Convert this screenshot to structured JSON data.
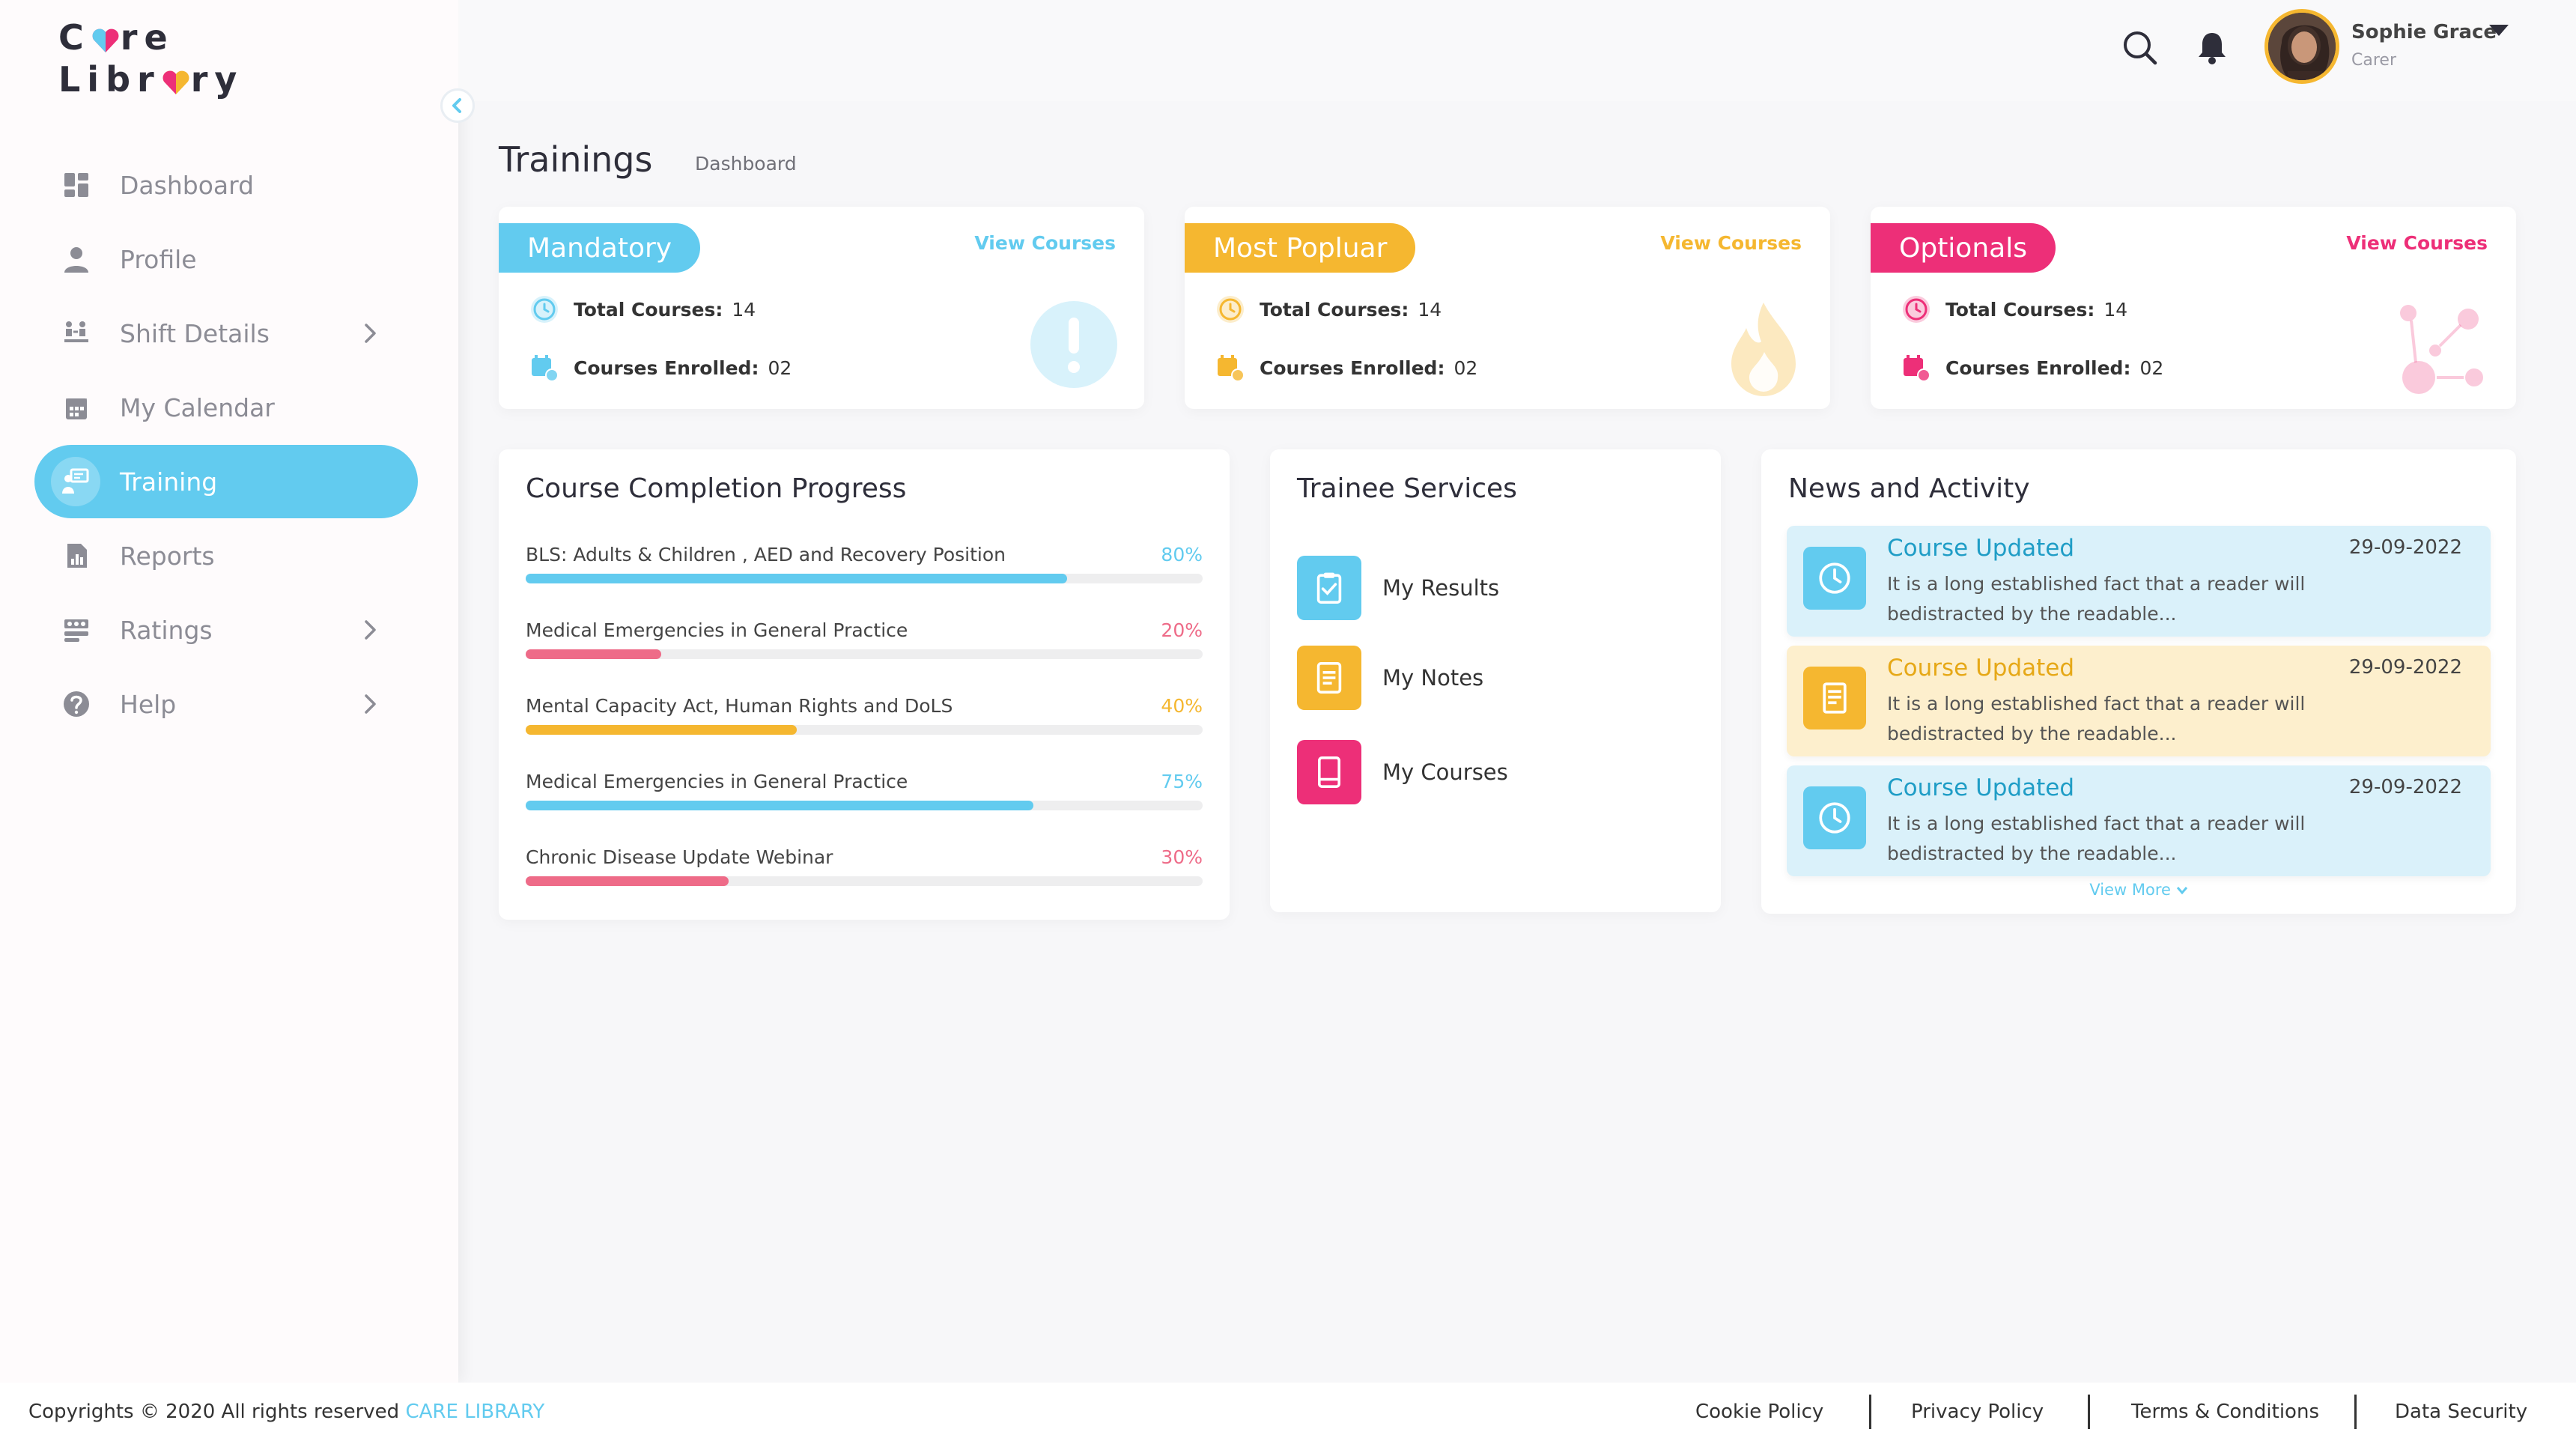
{
  "brand": {
    "logo_line1": "C",
    "logo_line1_rest": "re",
    "logo_line2": "Libr",
    "logo_line2_rest": "ry"
  },
  "nav": [
    {
      "label": "Dashboard",
      "icon": "dashboard-icon",
      "active": false,
      "chevron": false
    },
    {
      "label": "Profile",
      "icon": "user-icon",
      "active": false,
      "chevron": false
    },
    {
      "label": "Shift Details",
      "icon": "shift-icon",
      "active": false,
      "chevron": true
    },
    {
      "label": "My Calendar",
      "icon": "calendar-icon",
      "active": false,
      "chevron": false
    },
    {
      "label": "Training",
      "icon": "training-icon",
      "active": true,
      "chevron": false
    },
    {
      "label": "Reports",
      "icon": "reports-icon",
      "active": false,
      "chevron": false
    },
    {
      "label": "Ratings",
      "icon": "ratings-icon",
      "active": false,
      "chevron": true
    },
    {
      "label": "Help",
      "icon": "help-icon",
      "active": false,
      "chevron": true
    }
  ],
  "user": {
    "name": "Sophie Grace",
    "role": "Carer"
  },
  "page": {
    "title": "Trainings",
    "breadcrumb": "Dashboard"
  },
  "categories": [
    {
      "title": "Mandatory",
      "link": "View Courses",
      "total_label": "Total Courses:",
      "total": "14",
      "enrolled_label": "Courses Enrolled:",
      "enrolled": "02",
      "color": "#62cbef"
    },
    {
      "title": "Most Popluar",
      "link": "View Courses",
      "total_label": "Total Courses:",
      "total": "14",
      "enrolled_label": "Courses Enrolled:",
      "enrolled": "02",
      "color": "#f5b730"
    },
    {
      "title": "Optionals",
      "link": "View Courses",
      "total_label": "Total Courses:",
      "total": "14",
      "enrolled_label": "Courses Enrolled:",
      "enrolled": "02",
      "color": "#ed2f78"
    }
  ],
  "progress": {
    "title": "Course Completion Progress",
    "items": [
      {
        "label": "BLS: Adults & Children , AED and Recovery Position",
        "percent": "80%",
        "value": 0.8,
        "color": "#62cbef"
      },
      {
        "label": "Medical Emergencies in General Practice",
        "percent": "20%",
        "value": 0.2,
        "color": "#ee6b88"
      },
      {
        "label": "Mental Capacity Act, Human Rights and DoLS",
        "percent": "40%",
        "value": 0.4,
        "color": "#f5b730"
      },
      {
        "label": "Medical Emergencies in General Practice",
        "percent": "75%",
        "value": 0.75,
        "color": "#62cbef"
      },
      {
        "label": "Chronic Disease Update Webinar",
        "percent": "30%",
        "value": 0.3,
        "color": "#ee6b88"
      }
    ]
  },
  "services": {
    "title": "Trainee Services",
    "items": [
      {
        "label": "My Results",
        "icon": "clipboard-check-icon",
        "color": "#62cbef"
      },
      {
        "label": "My Notes",
        "icon": "notes-icon",
        "color": "#f5b730"
      },
      {
        "label": "My Courses",
        "icon": "book-icon",
        "color": "#ed2f78"
      }
    ]
  },
  "news": {
    "title": "News and Activity",
    "items": [
      {
        "title": "Course Updated",
        "date": "29-09-2022",
        "body": "It is a long established fact that a reader will bedistracted by the readable...",
        "bg": "#daf1fa",
        "accent": "#1f9dc6",
        "icon_bg": "#62cbef"
      },
      {
        "title": "Course Updated",
        "date": "29-09-2022",
        "body": "It is a long established fact that a reader will bedistracted by the readable...",
        "bg": "#fdefcd",
        "accent": "#e6a817",
        "icon_bg": "#f5b730"
      },
      {
        "title": "Course Updated",
        "date": "29-09-2022",
        "body": "It is a long established fact that a reader will bedistracted by the readable...",
        "bg": "#daf1fa",
        "accent": "#1f9dc6",
        "icon_bg": "#62cbef"
      }
    ],
    "view_more": "View More"
  },
  "footer": {
    "copyright": "Copyrights © 2020  All rights reserved",
    "brand": "CARE LIBRARY",
    "links": [
      "Cookie Policy",
      "Privacy Policy",
      "Terms & Conditions",
      "Data Security"
    ]
  }
}
